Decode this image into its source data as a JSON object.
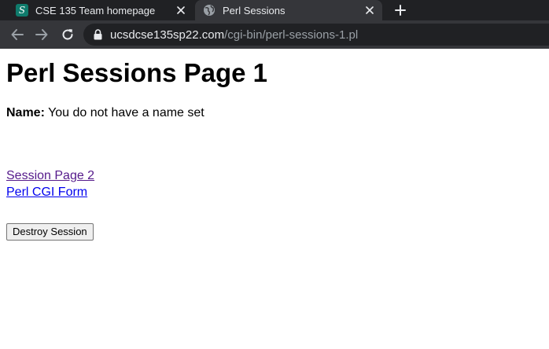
{
  "browser": {
    "tabs": [
      {
        "title": "CSE 135 Team homepage",
        "favicon_glyph": "S",
        "favicon": "team-logo-icon",
        "active": false
      },
      {
        "title": "Perl Sessions",
        "favicon": "globe-icon",
        "active": true
      }
    ],
    "toolbar": {
      "url_host": "ucsdcse135sp22.com",
      "url_path": "/cgi-bin/perl-sessions-1.pl"
    }
  },
  "page": {
    "title": "Perl Sessions Page 1",
    "name_label": "Name:",
    "name_value": " You do not have a name set",
    "links": [
      {
        "label": "Session Page 2",
        "visited": true
      },
      {
        "label": "Perl CGI Form",
        "visited": false
      }
    ],
    "destroy_button": "Destroy Session"
  },
  "colors": {
    "tabstrip_bg": "#202124",
    "active_tab_bg": "#35363a",
    "visited_link": "#551a8b",
    "link": "#0000ee"
  }
}
